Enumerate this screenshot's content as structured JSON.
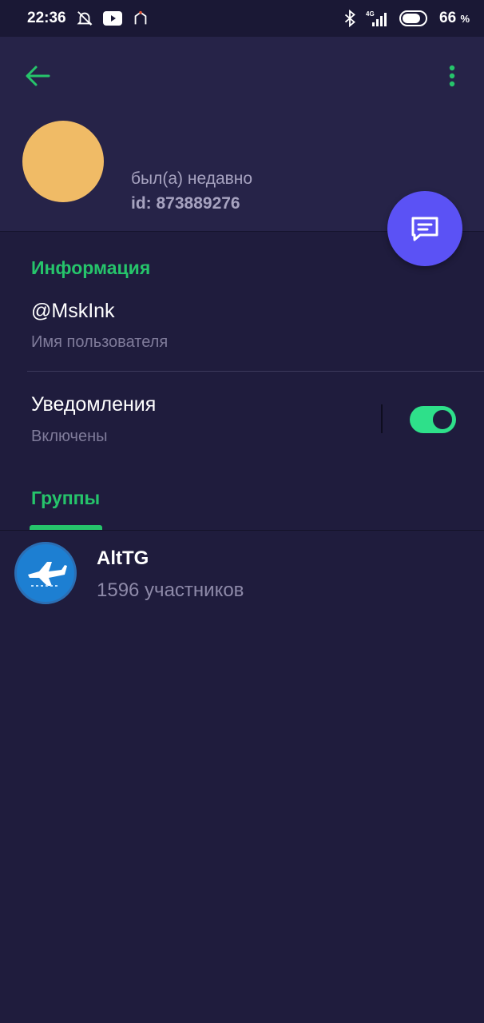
{
  "status_bar": {
    "time": "22:36",
    "battery": "66",
    "battery_unit": "%",
    "network": "4G",
    "icons": [
      "alarm-off-icon",
      "youtube-icon",
      "app-notification-icon",
      "bluetooth-icon",
      "signal-icon",
      "battery-icon"
    ]
  },
  "header": {
    "last_seen": "был(а) недавно",
    "user_id": "id: 873889276"
  },
  "info": {
    "section_title": "Информация",
    "username": "@MskInk",
    "username_caption": "Имя пользователя",
    "notifications_label": "Уведомления",
    "notifications_status": "Включены",
    "notifications_enabled": true
  },
  "groups": {
    "tab_label": "Группы",
    "items": [
      {
        "name": "AltTG",
        "members": "1596 участников"
      }
    ]
  },
  "colors": {
    "accent_green": "#26c46b",
    "fab": "#5b52f5",
    "avatar": "#f0bb66",
    "background": "#1f1c3d",
    "header": "#262348"
  }
}
